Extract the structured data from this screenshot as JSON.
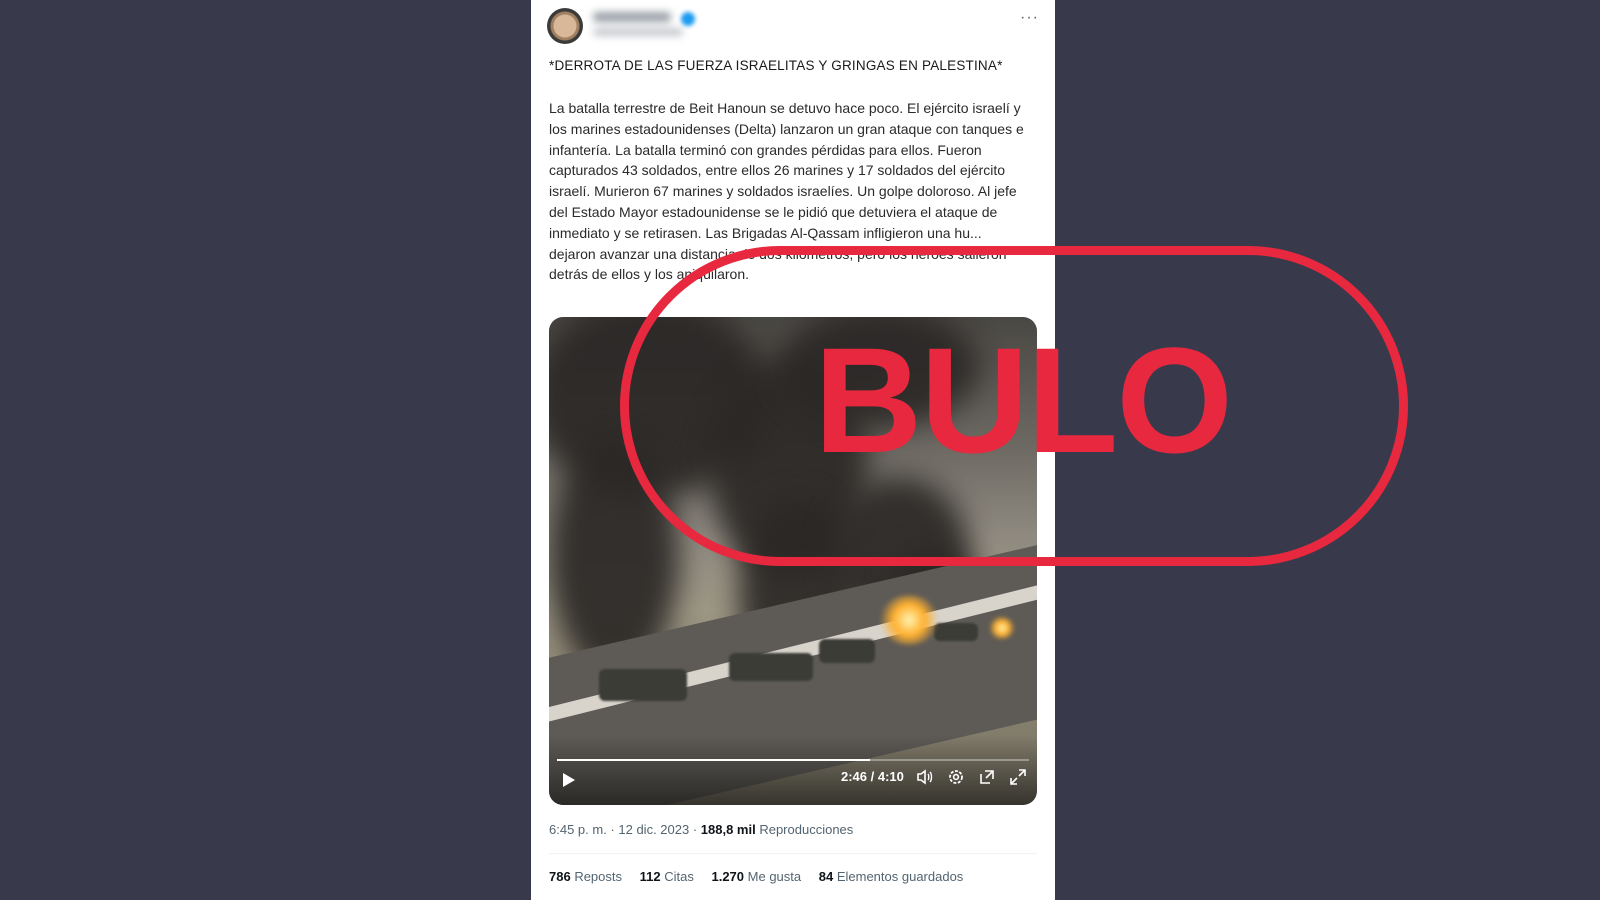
{
  "tweet": {
    "title": "*DERROTA DE LAS FUERZA ISRAELITAS Y GRINGAS EN PALESTINA*",
    "body": "La batalla terrestre de Beit Hanoun se detuvo hace poco. El ejército israelí y los marines estadounidenses (Delta) lanzaron un gran ataque con tanques e infantería. La batalla terminó con grandes pérdidas para ellos. Fueron capturados 43 soldados, entre ellos 26 marines y 17 soldados del ejército israelí. Murieron 67 marines y soldados israelíes. Un golpe doloroso. Al jefe del Estado Mayor estadounidense se le pidió que detuviera el ataque de inmediato y se retirasen. Las Brigadas Al-Qassam infligieron una hu... dejaron avanzar una distancia de dos kilómetros, pero los héroes salieron detrás de ellos y los aniquilaron.",
    "more_icon": "···"
  },
  "video": {
    "time": "2:46 / 4:10",
    "progress": 0.664
  },
  "meta": {
    "time": "6:45 p. m.",
    "sep1": " · ",
    "date": "12 dic. 2023",
    "sep2": " · ",
    "views_count": "188,8 mil",
    "views_label": " Reproducciones"
  },
  "stats": [
    {
      "count": "786",
      "label": " Reposts"
    },
    {
      "count": "112",
      "label": " Citas"
    },
    {
      "count": "1.270",
      "label": " Me gusta"
    },
    {
      "count": "84",
      "label": " Elementos guardados"
    }
  ],
  "stamp": {
    "text": "BULO",
    "color": "#e8283e"
  }
}
